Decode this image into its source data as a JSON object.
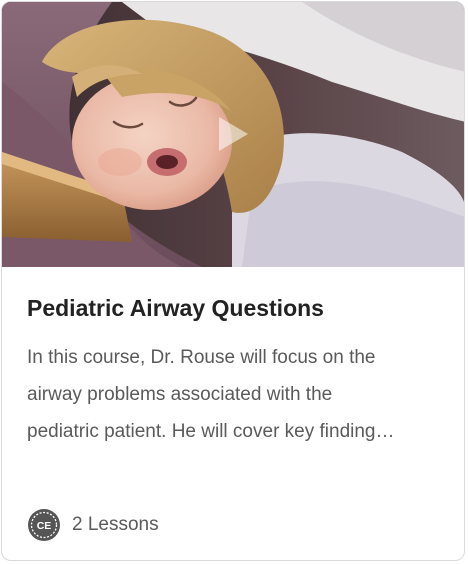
{
  "card": {
    "title": "Pediatric Airway Questions",
    "description_lines": [
      "In this course, Dr. Rouse will focus on the",
      "airway problems associated with the",
      "pediatric patient. He will cover key finding…"
    ],
    "badge_text": "CE",
    "lessons_label": "2 Lessons"
  },
  "colors": {
    "title": "#222222",
    "body_text": "#5a5a5a",
    "border": "#d9d9d9",
    "badge": "#555555"
  },
  "icons": {
    "thumbnail_overlay": "play-icon",
    "footer_badge": "ce-badge-icon"
  }
}
